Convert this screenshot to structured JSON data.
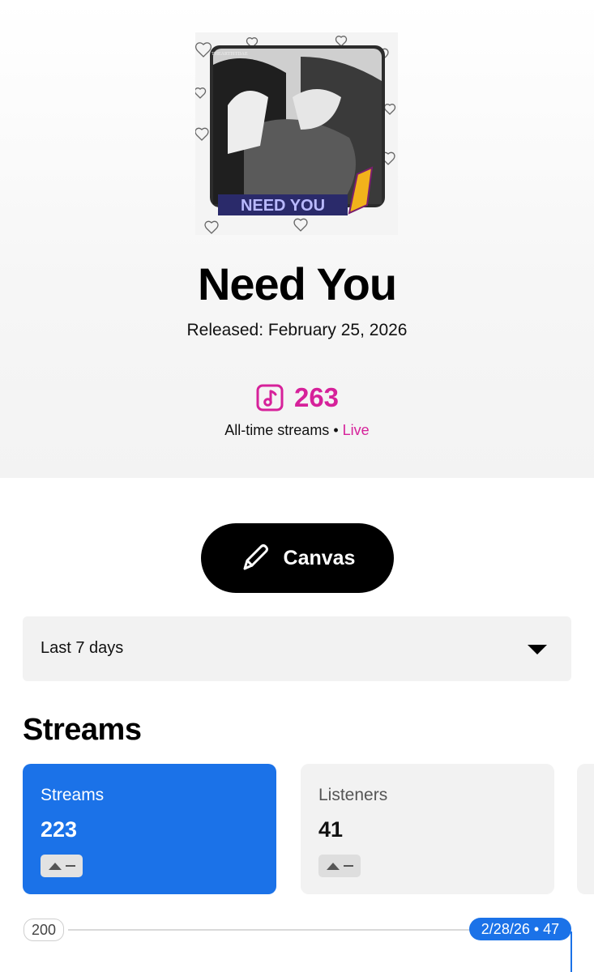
{
  "track": {
    "cover_text_top": "THEARTISTDAE",
    "cover_text_bottom": "NEED YOU",
    "title": "Need You",
    "released": "Released: February 25, 2026",
    "total_streams": "263",
    "alltime_label": "All-time streams",
    "separator": "•",
    "live_label": "Live",
    "note_icon": "music-note-icon"
  },
  "actions": {
    "canvas_label": "Canvas",
    "canvas_icon": "pencil-icon"
  },
  "period_select": {
    "value": "Last 7 days",
    "icon": "caret-down-icon"
  },
  "section": {
    "title": "Streams"
  },
  "metrics": [
    {
      "label": "Streams",
      "value": "223",
      "trend": "—",
      "selected": true
    },
    {
      "label": "Listeners",
      "value": "41",
      "trend": "—",
      "selected": false
    }
  ],
  "chart": {
    "y_tick": "200",
    "tooltip": "2/28/26 • 47"
  },
  "colors": {
    "accent_pink": "#d6219a",
    "accent_blue": "#1b72e8",
    "button_black": "#000000",
    "card_grey": "#f2f2f2"
  }
}
